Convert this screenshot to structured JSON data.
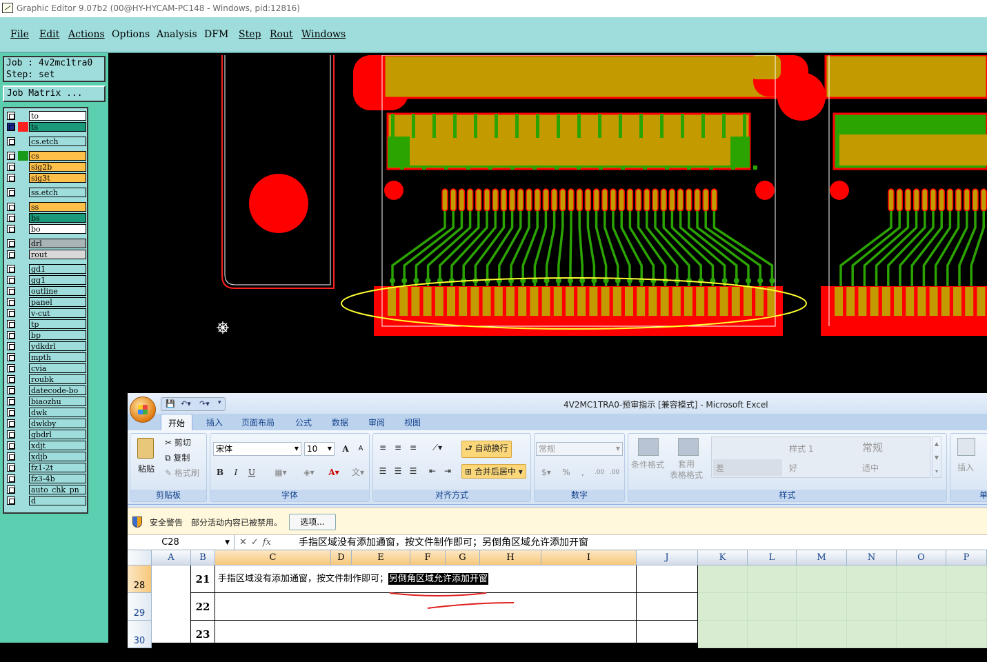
{
  "window": {
    "title": "Graphic Editor 9.07b2 (00@HY-HYCAM-PC148 - Windows, pid:12816)"
  },
  "menu": [
    "File",
    "Edit",
    "Actions",
    "Options",
    "Analysis",
    "DFM",
    "Step",
    "Rout",
    "Windows"
  ],
  "job": {
    "job_line": "Job  : 4v2mc1tra0",
    "step_line": "Step: set",
    "matrix_button": "Job Matrix ..."
  },
  "layers": [
    {
      "name": "to",
      "color": "#ffffff"
    },
    {
      "name": "ts",
      "color": "#1a9a7a"
    },
    {
      "name": "cs.etch",
      "color": "#9fdcdc"
    },
    {
      "name": "cs",
      "color": "#ffc04a"
    },
    {
      "name": "sig2b",
      "color": "#ffc04a"
    },
    {
      "name": "sig3t",
      "color": "#ffc04a"
    },
    {
      "name": "ss.etch",
      "color": "#9fdcdc"
    },
    {
      "name": "ss",
      "color": "#ffc04a"
    },
    {
      "name": "bs",
      "color": "#1a9a7a"
    },
    {
      "name": "bo",
      "color": "#ffffff"
    },
    {
      "name": "drl",
      "color": "#a8b4b8"
    },
    {
      "name": "rout",
      "color": "#d8d8d8"
    },
    {
      "name": "gd1",
      "color": "#9fdcdc"
    },
    {
      "name": "gg1",
      "color": "#9fdcdc"
    },
    {
      "name": "outline",
      "color": "#9fdcdc"
    },
    {
      "name": "panel",
      "color": "#9fdcdc"
    },
    {
      "name": "v-cut",
      "color": "#9fdcdc"
    },
    {
      "name": "tp",
      "color": "#9fdcdc"
    },
    {
      "name": "bp",
      "color": "#9fdcdc"
    },
    {
      "name": "ydkdrl",
      "color": "#9fdcdc"
    },
    {
      "name": "mpth",
      "color": "#9fdcdc"
    },
    {
      "name": "cvia",
      "color": "#9fdcdc"
    },
    {
      "name": "roubk",
      "color": "#9fdcdc"
    },
    {
      "name": "datecode-bo",
      "color": "#9fdcdc"
    },
    {
      "name": "biaozhu",
      "color": "#9fdcdc"
    },
    {
      "name": "dwk",
      "color": "#9fdcdc"
    },
    {
      "name": "dwkby",
      "color": "#9fdcdc"
    },
    {
      "name": "gbdrl",
      "color": "#9fdcdc"
    },
    {
      "name": "xdjt",
      "color": "#9fdcdc"
    },
    {
      "name": "xdjb",
      "color": "#9fdcdc"
    },
    {
      "name": "fz1-2t",
      "color": "#9fdcdc"
    },
    {
      "name": "fz3-4b",
      "color": "#9fdcdc"
    },
    {
      "name": "auto_chk_pn",
      "color": "#9fdcdc"
    },
    {
      "name": "d",
      "color": "#9fdcdc"
    }
  ],
  "excel": {
    "title": "4V2MC1TRA0-预审指示  [兼容模式] - Microsoft Excel",
    "tabs": [
      "开始",
      "插入",
      "页面布局",
      "公式",
      "数据",
      "审阅",
      "视图"
    ],
    "clipboard": {
      "paste": "粘贴",
      "cut": "剪切",
      "copy": "复制",
      "format_painter": "格式刷",
      "group": "剪贴板"
    },
    "font": {
      "name": "宋体",
      "size": "10",
      "group": "字体",
      "bold": "B",
      "italic": "I",
      "underline": "U",
      "grow": "A",
      "shrink": "A",
      "font_color": "A"
    },
    "alignment": {
      "wrap": "自动换行",
      "merge": "合并后居中",
      "group": "对齐方式"
    },
    "number": {
      "format": "常规",
      "percent": "%",
      "comma": ",",
      "group": "数字",
      "inc": ".00",
      "dec": ".00"
    },
    "styles": {
      "conditional": "条件格式",
      "table": "套用\n表格格式",
      "style1": "样式 1",
      "normal": "常规",
      "bad": "差",
      "good": "好",
      "neutral": "适中",
      "group": "样式"
    },
    "cells": {
      "insert": "插入",
      "group": "单"
    },
    "security": {
      "label": "安全警告",
      "message": "部分活动内容已被禁用。",
      "options_button": "选项..."
    },
    "namebox": "C28",
    "fx": "fx",
    "formula": "手指区域没有添加通窗，按文件制作即可；另倒角区域允许添加开窗",
    "columns": [
      "A",
      "B",
      "C",
      "D",
      "E",
      "F",
      "G",
      "H",
      "I",
      "J",
      "K",
      "L",
      "M",
      "N",
      "O",
      "P"
    ],
    "rows": [
      {
        "row": "28",
        "num": "21",
        "text": "手指区域没有添加通窗，按文件制作即可；",
        "highlight": "另倒角区域允许添加开窗"
      },
      {
        "row": "29",
        "num": "22",
        "text": "",
        "highlight": ""
      },
      {
        "row": "30",
        "num": "23",
        "text": "",
        "highlight": ""
      }
    ]
  },
  "colors": {
    "pad": "#c39a00",
    "red": "#ff0000",
    "green": "#2ba300",
    "teal": "#5ccfb0",
    "menu": "#9fdcdc"
  }
}
